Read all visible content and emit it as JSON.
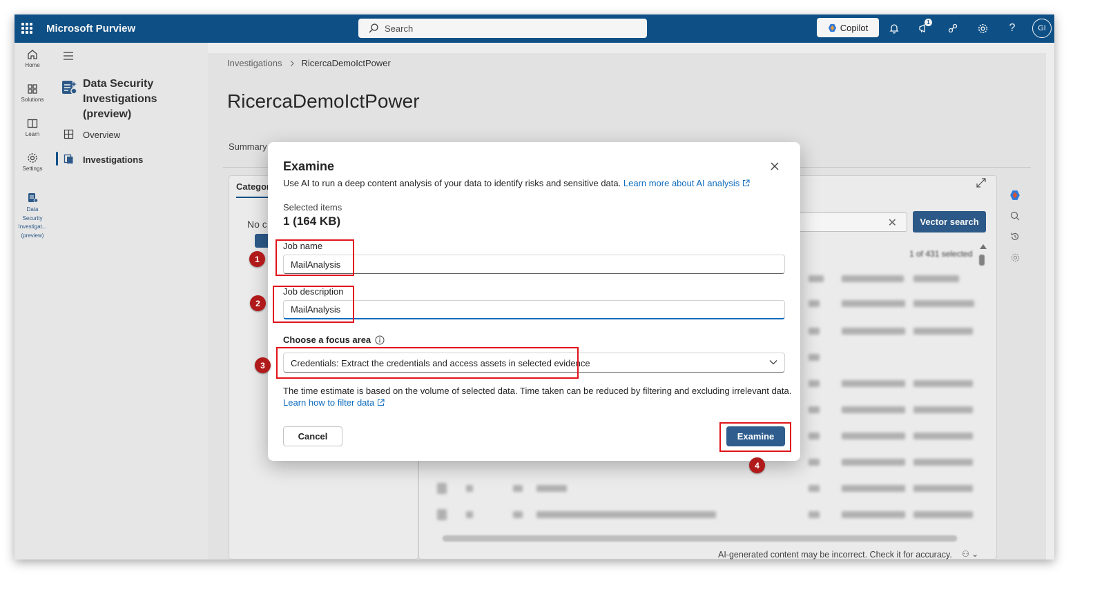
{
  "topbar": {
    "app_name": "Microsoft Purview",
    "search_placeholder": "Search",
    "copilot_label": "Copilot",
    "notification_count": "1",
    "avatar_initials": "GI"
  },
  "rail": {
    "items": [
      {
        "label": "Home",
        "icon": "home-icon"
      },
      {
        "label": "Solutions",
        "icon": "solutions-icon"
      },
      {
        "label": "Learn",
        "icon": "book-icon"
      },
      {
        "label": "Settings",
        "icon": "gear-icon"
      },
      {
        "label_lines": [
          "Data",
          "Security",
          "Investigat...",
          "(preview)"
        ],
        "icon": "data-security-icon"
      }
    ]
  },
  "nav": {
    "title": "Data Security Investigations (preview)",
    "items": [
      {
        "label": "Overview",
        "icon": "grid-icon"
      },
      {
        "label": "Investigations",
        "icon": "investigations-icon",
        "active": true
      }
    ]
  },
  "page": {
    "breadcrumb": [
      "Investigations",
      "RicercaDemoIctPower"
    ],
    "title": "RicercaDemoIctPower",
    "tab_summary": "Summary",
    "left_card_tab": "Categori",
    "left_card_empty": "No c",
    "vector_search_label": "Vector search",
    "selected_count": "1 of 431 selected",
    "ai_disclaimer": "AI-generated content may be incorrect. Check it for accuracy."
  },
  "dialog": {
    "title": "Examine",
    "description": "Use AI to run a deep content analysis of your data to identify risks and sensitive data.",
    "learn_more_link": "Learn more about AI analysis",
    "selected_items_label": "Selected items",
    "selected_items_value": "1 (164 KB)",
    "job_name_label": "Job name",
    "job_name_value": "MailAnalysis",
    "job_description_label": "Job description",
    "job_description_value": "MailAnalysis",
    "focus_area_label": "Choose a focus area",
    "focus_area_value": "Credentials: Extract the credentials and access assets in selected evidence",
    "time_note": "The time estimate is based on the volume of selected data. Time taken can be reduced by filtering and excluding irrelevant data.",
    "filter_link": "Learn how to filter data",
    "cancel_label": "Cancel",
    "examine_label": "Examine"
  },
  "callouts": [
    "1",
    "2",
    "3",
    "4"
  ],
  "colors": {
    "topbar": "#0f548c",
    "primary_button": "#2e5d8e",
    "link": "#0f6cbd",
    "highlight": "#e0131a",
    "badge": "#b01a1a"
  }
}
